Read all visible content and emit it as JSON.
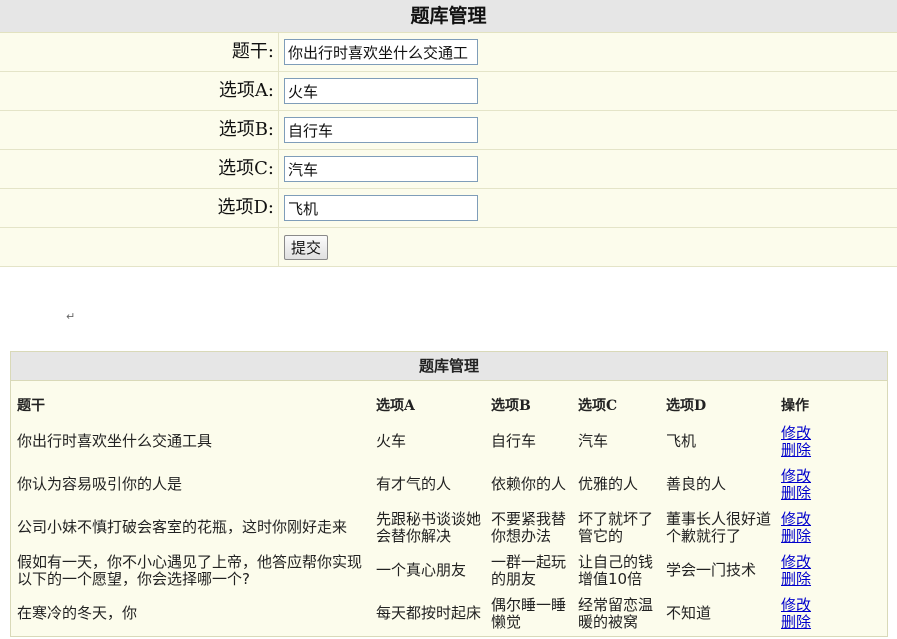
{
  "form": {
    "title": "题库管理",
    "fields": [
      {
        "label": "题干:",
        "value": "你出行时喜欢坐什么交通工"
      },
      {
        "label": "选项A:",
        "value": "火车"
      },
      {
        "label": "选项B:",
        "value": "自行车"
      },
      {
        "label": "选项C:",
        "value": "汽车"
      },
      {
        "label": "选项D:",
        "value": "飞机"
      }
    ],
    "submit_label": "提交"
  },
  "return_mark": "↵",
  "table": {
    "title": "题库管理",
    "headers": [
      "题干",
      "选项A",
      "选项B",
      "选项C",
      "选项D",
      "操作"
    ],
    "rows": [
      {
        "stem": "你出行时喜欢坐什么交通工具",
        "a": "火车",
        "b": "自行车",
        "c": "汽车",
        "d": "飞机",
        "edit": "修改",
        "delete": "删除"
      },
      {
        "stem": "你认为容易吸引你的人是",
        "a": "有才气的人",
        "b": "依赖你的人",
        "c": "优雅的人",
        "d": "善良的人",
        "edit": "修改",
        "delete": "删除"
      },
      {
        "stem": "公司小妹不慎打破会客室的花瓶，这时你刚好走来",
        "a": "先跟秘书谈谈她会替你解决",
        "b": "不要紧我替你想办法",
        "c": "坏了就坏了管它的",
        "d": "董事长人很好道个歉就行了",
        "edit": "修改",
        "delete": "删除"
      },
      {
        "stem": "假如有一天，你不小心遇见了上帝，他答应帮你实现以下的一个愿望，你会选择哪一个?",
        "a": "一个真心朋友",
        "b": "一群一起玩的朋友",
        "c": "让自己的钱增值10倍",
        "d": "学会一门技术",
        "edit": "修改",
        "delete": "删除"
      },
      {
        "stem": "在寒冷的冬天，你",
        "a": "每天都按时起床",
        "b": "偶尔睡一睡懒觉",
        "c": "经常留恋温暖的被窝",
        "d": "不知道",
        "edit": "修改",
        "delete": "删除"
      }
    ]
  }
}
